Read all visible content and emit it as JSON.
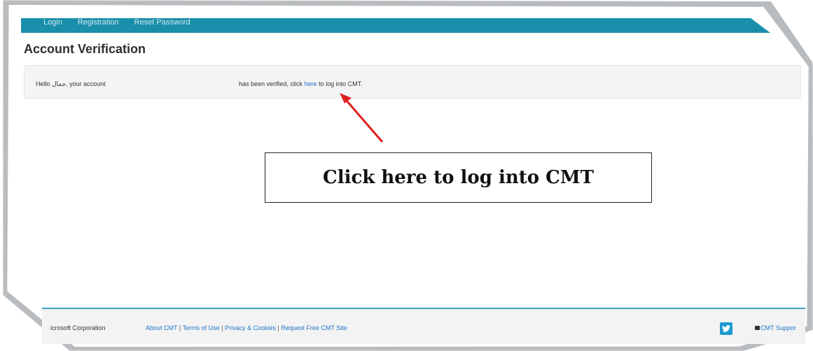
{
  "nav": {
    "items": [
      "Login",
      "Registration",
      "Reset Password"
    ]
  },
  "page": {
    "title": "Account Verification"
  },
  "verification": {
    "left_text": "Hello جمال, your account",
    "right_text_before": "has been verified, click ",
    "link_text": "here",
    "right_text_after": " to log into CMT."
  },
  "callout": {
    "text": "Click here to log into CMT"
  },
  "footer": {
    "copyright": "icrosoft Corporation",
    "links": [
      "About CMT",
      "Terms of Use",
      "Privacy & Cookies",
      "Request Free CMT Site"
    ],
    "separator": "|",
    "support_text": "CMT Suppor"
  },
  "colors": {
    "nav_bg": "#1a8fab",
    "link": "#1f74c7",
    "arrow": "#e0201f",
    "footer_line": "#3aa2c0"
  },
  "icons": {
    "twitter": "twitter-icon",
    "support": "envelope-icon",
    "arrow": "red-arrow"
  }
}
